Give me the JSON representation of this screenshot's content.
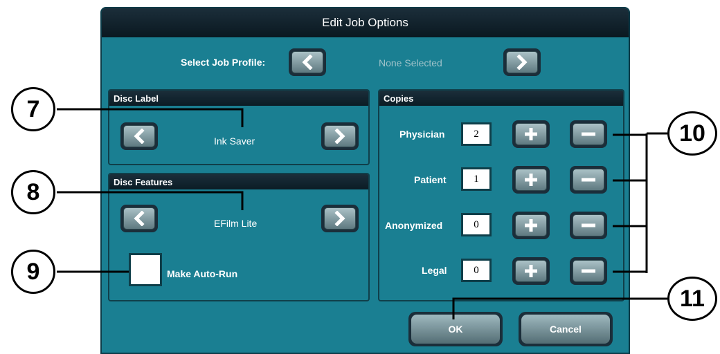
{
  "dialog": {
    "title": "Edit Job Options",
    "job_profile": {
      "label": "Select Job Profile:",
      "value": "None Selected"
    }
  },
  "disc_label": {
    "header": "Disc Label",
    "value": "Ink Saver"
  },
  "disc_features": {
    "header": "Disc Features",
    "value": "EFilm Lite",
    "autorun_label": "Make Auto-Run",
    "autorun_checked": false
  },
  "copies": {
    "header": "Copies",
    "rows": [
      {
        "label": "Physician",
        "value": "2"
      },
      {
        "label": "Patient",
        "value": "1"
      },
      {
        "label": "Anonymized",
        "value": "0"
      },
      {
        "label": "Legal",
        "value": "0"
      }
    ]
  },
  "buttons": {
    "ok": "OK",
    "cancel": "Cancel"
  },
  "callouts": [
    "7",
    "8",
    "9",
    "10",
    "11"
  ],
  "colors": {
    "dialog_bg": "#1a7f92",
    "titlebar": "#1b2e3a",
    "button_face": "#8aa5ab"
  },
  "icons": {
    "prev": "chevron-left-icon",
    "next": "chevron-right-icon",
    "plus": "plus-icon",
    "minus": "minus-icon"
  }
}
